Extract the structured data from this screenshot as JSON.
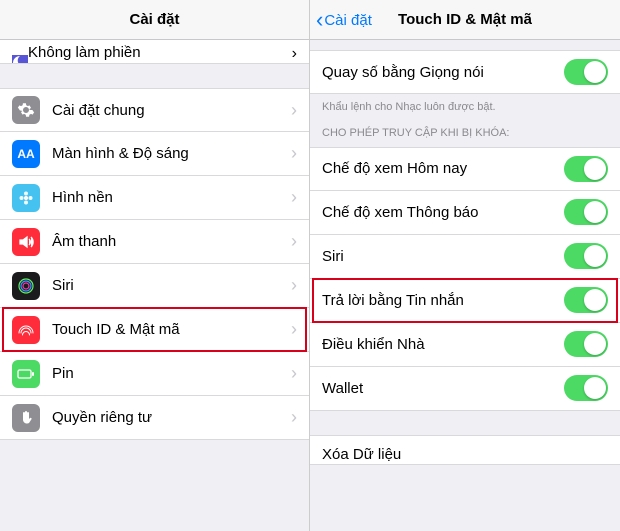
{
  "left": {
    "navTitle": "Cài đặt",
    "items": [
      {
        "label": "Không làm phiền",
        "iconBg": "#5856d6",
        "icon": "moon",
        "highlight": false,
        "partial": true
      },
      {
        "label": "Cài đặt chung",
        "iconBg": "#8e8e93",
        "icon": "gear",
        "highlight": false
      },
      {
        "label": "Màn hình & Độ sáng",
        "iconBg": "#0079ff",
        "icon": "aa",
        "highlight": false
      },
      {
        "label": "Hình nền",
        "iconBg": "#46c2f0",
        "icon": "flower",
        "highlight": false
      },
      {
        "label": "Âm thanh",
        "iconBg": "#ff2d3b",
        "icon": "speaker",
        "highlight": false
      },
      {
        "label": "Siri",
        "iconBg": "#1b1b1d",
        "icon": "siri",
        "highlight": false
      },
      {
        "label": "Touch ID & Mật mã",
        "iconBg": "#ff2d3b",
        "icon": "fingerprint",
        "highlight": true
      },
      {
        "label": "Pin",
        "iconBg": "#4cd964",
        "icon": "battery",
        "highlight": false
      },
      {
        "label": "Quyền riêng tư",
        "iconBg": "#8e8e93",
        "icon": "hand",
        "highlight": false
      }
    ]
  },
  "right": {
    "backLabel": "Cài đặt",
    "navTitle": "Touch ID & Mật mã",
    "voiceDial": {
      "label": "Quay số bằng Giọng nói"
    },
    "caption1": "Khẩu lệnh cho Nhạc luôn được bật.",
    "sectionHeader": "CHO PHÉP TRUY CẬP KHI BỊ KHÓA:",
    "allowAccess": [
      {
        "label": "Chế độ xem Hôm nay",
        "highlight": false
      },
      {
        "label": "Chế độ xem Thông báo",
        "highlight": false
      },
      {
        "label": "Siri",
        "highlight": false
      },
      {
        "label": "Trả lời bằng Tin nhắn",
        "highlight": true
      },
      {
        "label": "Điều khiển Nhà",
        "highlight": false
      },
      {
        "label": "Wallet",
        "highlight": false
      }
    ],
    "erase": {
      "label": "Xóa Dữ liệu"
    }
  }
}
